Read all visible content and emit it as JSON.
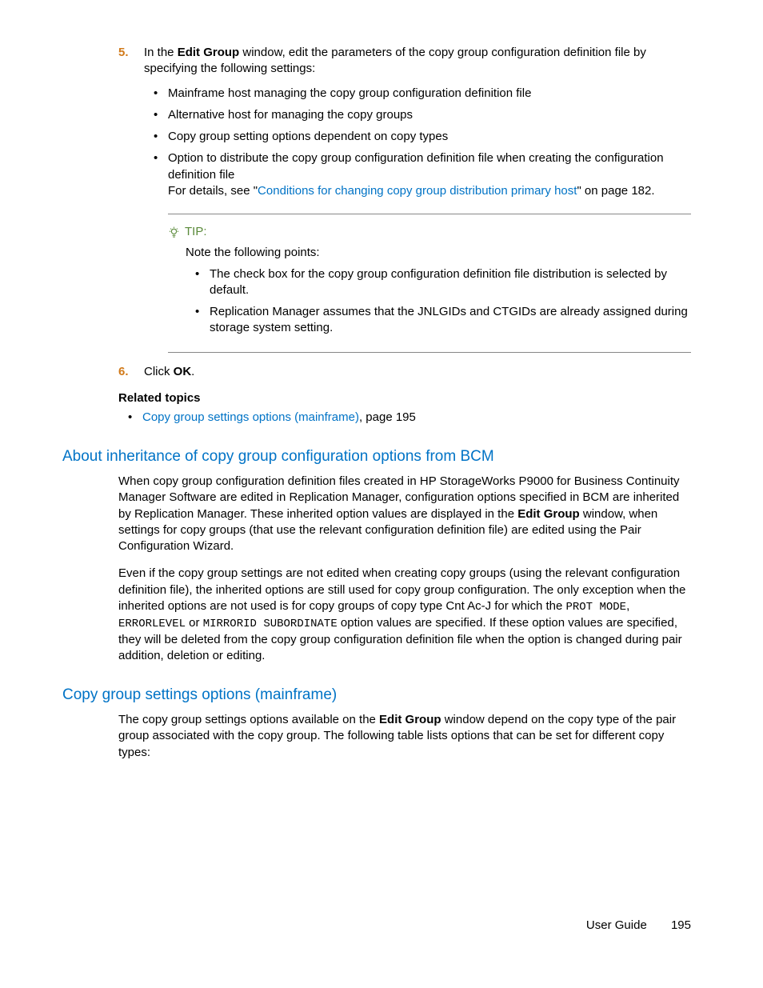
{
  "step5": {
    "num": "5.",
    "pre": "In the ",
    "bold1": "Edit Group",
    "post": " window, edit the parameters of the copy group configuration definition file by specifying the following settings:",
    "bullets": [
      "Mainframe host managing the copy group configuration definition file",
      "Alternative host for managing the copy groups",
      "Copy group setting options dependent on copy types"
    ],
    "bullet4_a": "Option to distribute the copy group configuration definition file when creating the configuration definition file",
    "bullet4_b_pre": "For details, see \"",
    "bullet4_b_link": "Conditions for changing copy group distribution primary host",
    "bullet4_b_post": "\" on page 182."
  },
  "tip": {
    "label": "TIP:",
    "intro": "Note the following points:",
    "b1": "The check box for the copy group configuration definition file distribution is selected by default.",
    "b2": "Replication Manager assumes that the JNLGIDs and CTGIDs are already assigned during storage system setting."
  },
  "step6": {
    "num": "6.",
    "pre": "Click ",
    "bold": "OK",
    "post": "."
  },
  "related": {
    "head": "Related topics",
    "link": "Copy group settings options (mainframe)",
    "post": ", page 195"
  },
  "h1": "About inheritance of copy group configuration options from BCM",
  "p1": {
    "a": "When copy group configuration definition files created in HP StorageWorks P9000 for Business Continuity Manager Software are edited in Replication Manager, configuration options specified in BCM are inherited by Replication Manager. These inherited option values are displayed in the ",
    "bold": "Edit Group",
    "b": " window, when settings for copy groups (that use the relevant configuration definition file) are edited using the Pair Configuration Wizard."
  },
  "p2": {
    "a": "Even if the copy group settings are not edited when creating copy groups (using the relevant configuration definition file), the inherited options are still used for copy group configuration. The only exception when the inherited options are not used is for copy groups of copy type Cnt Ac-J for which the ",
    "m1": "PROT MODE",
    "b": ", ",
    "m2": "ERRORLEVEL",
    "c": " or ",
    "m3": "MIRRORID SUBORDINATE",
    "d": " option values are specified. If these option values are specified, they will be deleted from the copy group configuration definition file when the option is changed during pair addition, deletion or editing."
  },
  "h2": "Copy group settings options (mainframe)",
  "p3": {
    "a": "The copy group settings options available on the ",
    "bold": "Edit Group",
    "b": " window depend on the copy type of the pair group associated with the copy group. The following table lists options that can be set for different copy types:"
  },
  "footer": {
    "label": "User Guide",
    "page": "195"
  }
}
